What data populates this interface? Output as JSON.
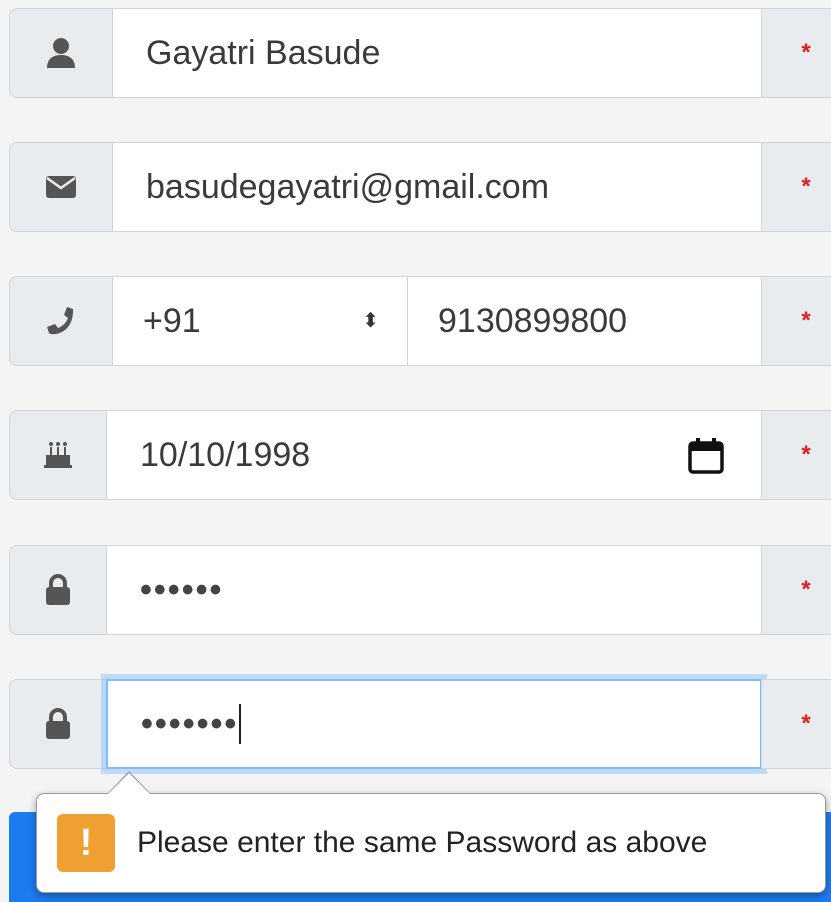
{
  "form": {
    "name": {
      "icon": "user-icon",
      "value": "Gayatri Basude",
      "required_marker": "*"
    },
    "email": {
      "icon": "envelope-icon",
      "value": "basudegayatri@gmail.com",
      "required_marker": "*"
    },
    "phone": {
      "icon": "phone-icon",
      "country_code": "+91",
      "number": "9130899800",
      "required_marker": "*"
    },
    "dob": {
      "icon": "birthday-cake-icon",
      "value": "10/10/1998",
      "required_marker": "*"
    },
    "password": {
      "icon": "lock-icon",
      "masked_value": "••••••",
      "required_marker": "*"
    },
    "confirm_password": {
      "icon": "lock-icon",
      "masked_value": "•••••••",
      "required_marker": "*"
    }
  },
  "validation_tooltip": {
    "icon": "warning-icon",
    "glyph": "!",
    "message": "Please enter the same Password as above"
  },
  "colors": {
    "required": "#e0201e",
    "addon_bg": "#e9ecef",
    "focus_border": "#80bdff",
    "submit_button": "#1d7bf0",
    "warning": "#f0a030"
  }
}
